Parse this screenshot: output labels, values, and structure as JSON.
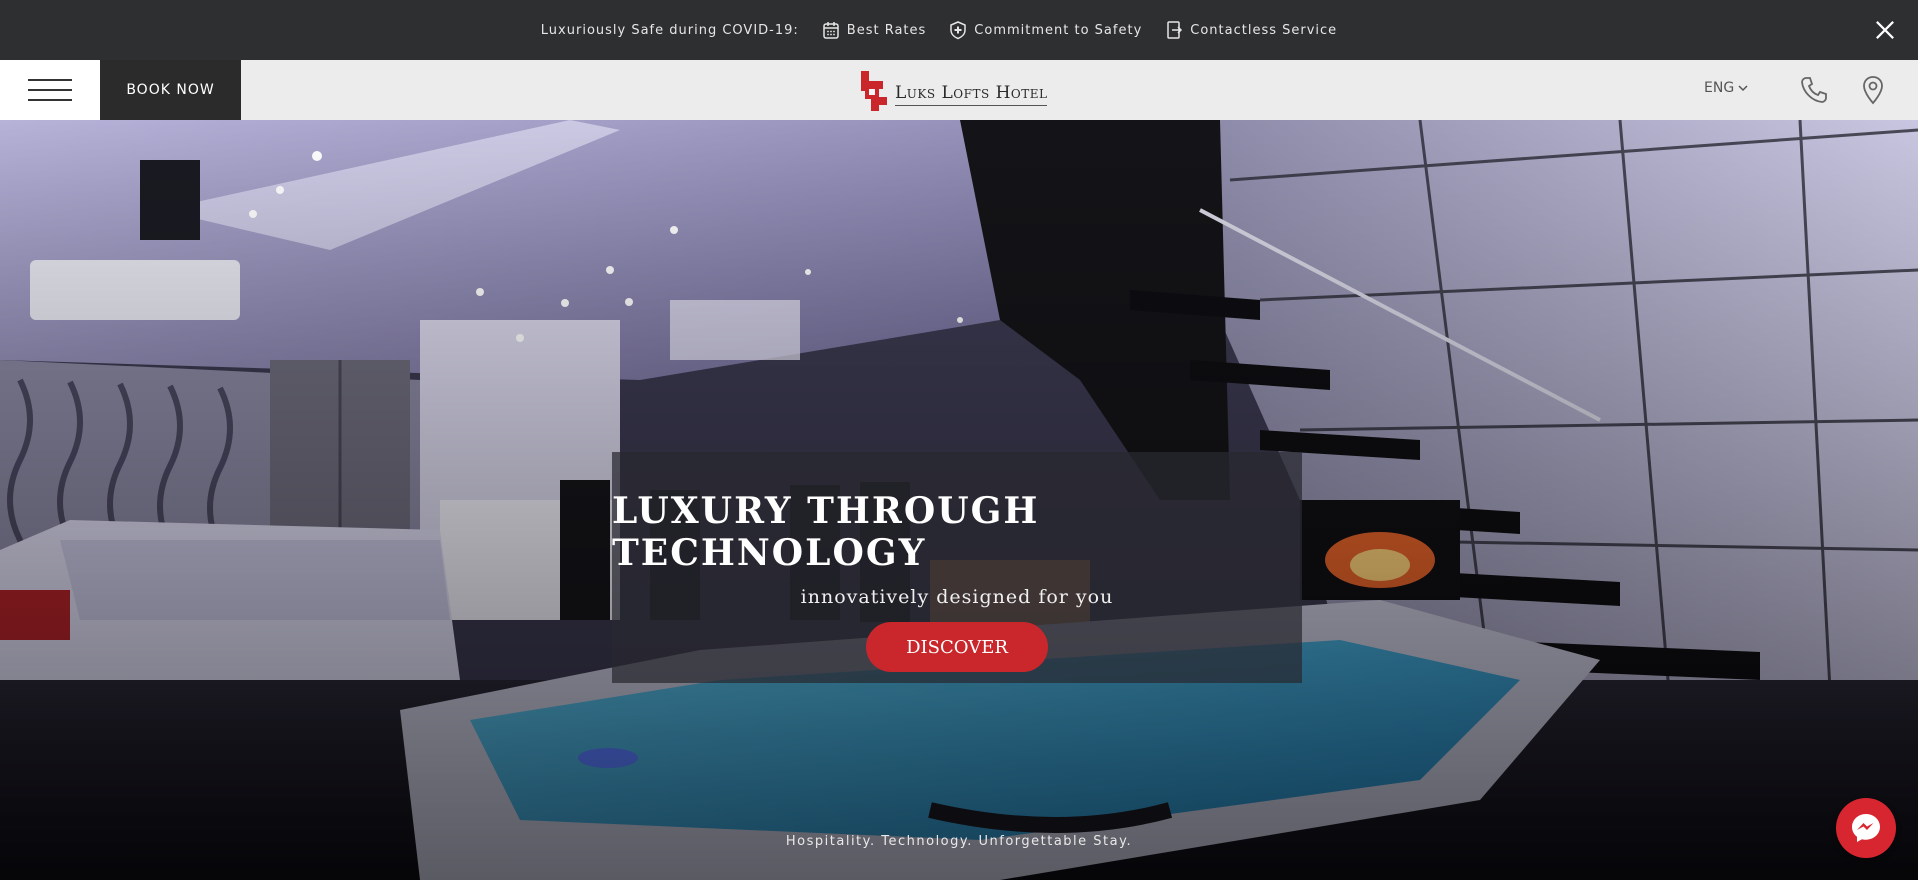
{
  "topbar": {
    "intro": "Luxuriously Safe during COVID-19:",
    "items": [
      {
        "label": "Best Rates",
        "icon": "calendar-icon"
      },
      {
        "label": "Commitment to Safety",
        "icon": "shield-plus-icon"
      },
      {
        "label": "Contactless Service",
        "icon": "contactless-door-icon"
      }
    ],
    "close_icon": "close-icon"
  },
  "header": {
    "book_now": "BOOK NOW",
    "logo_text": "Luks Lofts Hotel",
    "language": "ENG",
    "phone_icon": "phone-icon",
    "location_icon": "location-pin-icon"
  },
  "hero": {
    "headline": "LUXURY THROUGH TECHNOLOGY",
    "subheadline": "innovatively designed for you",
    "cta": "DISCOVER",
    "tagline": "Hospitality. Technology. Unforgettable Stay."
  },
  "colors": {
    "accent": "#c9272b",
    "topbar_bg": "#2e2f31",
    "header_bg": "#f5f5f5",
    "book_now_bg": "#2b2b2b",
    "messenger": "#d72630"
  }
}
